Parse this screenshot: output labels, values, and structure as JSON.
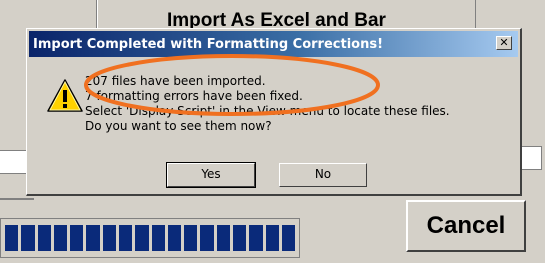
{
  "background": {
    "top_button_label": "Import As Excel and Bar",
    "cancel_label": "Cancel",
    "progress_segments": 18
  },
  "dialog": {
    "title": "Import Completed with Formatting Corrections!",
    "close_symbol": "✕",
    "messages": [
      "207 files have been imported.",
      "7 formatting errors have been fixed.",
      "Select 'Display Script' in the View menu to locate these files.",
      "Do you want to see them now?"
    ],
    "yes_label": "Yes",
    "no_label": "No",
    "icon": "warning-icon"
  },
  "colors": {
    "annotation": "#f07020",
    "title_start": "#0a246a",
    "title_end": "#a6caf0",
    "progress": "#0a2a7a"
  }
}
